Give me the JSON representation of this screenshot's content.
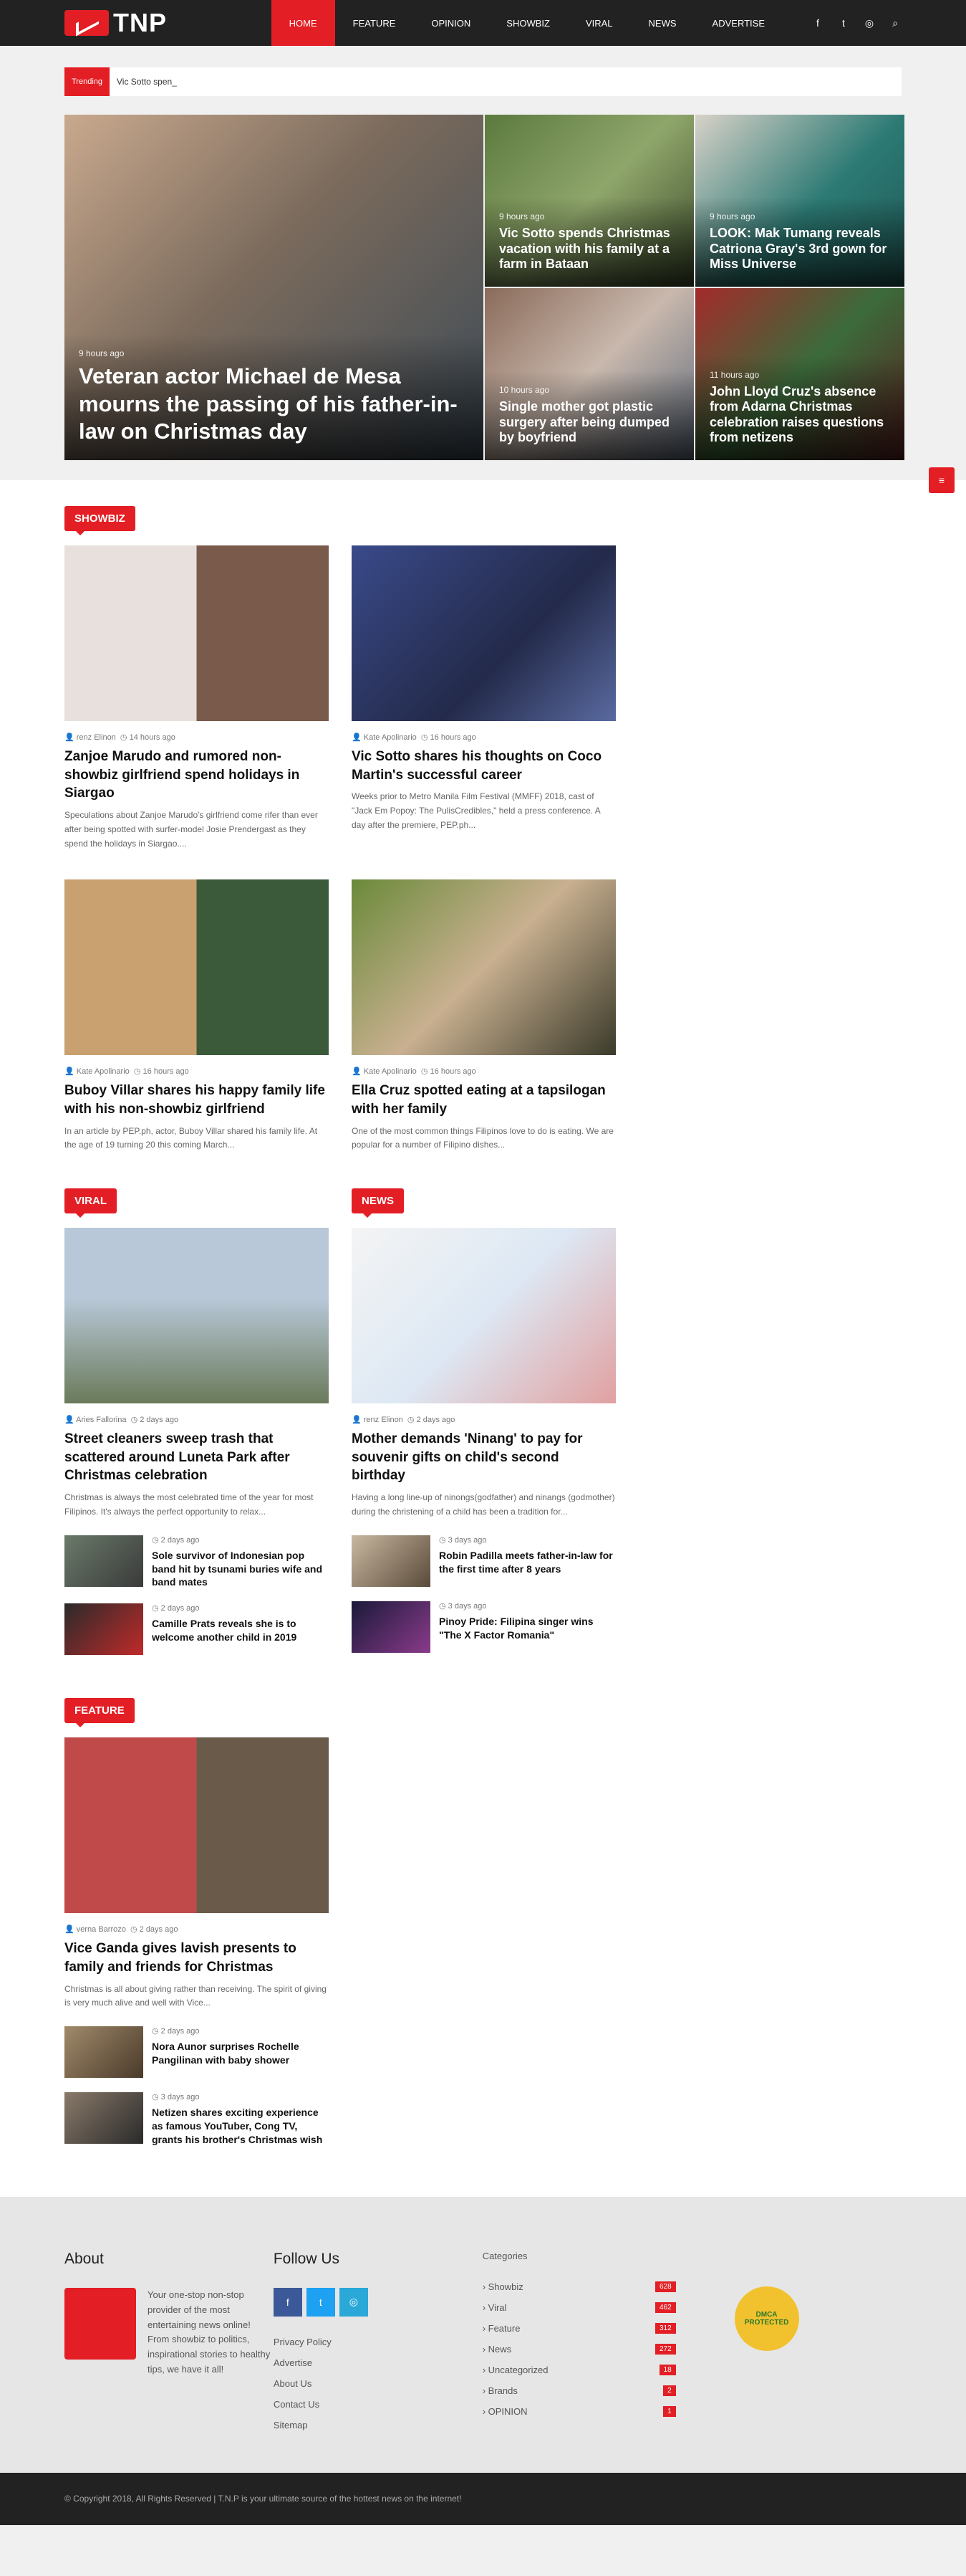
{
  "nav": {
    "logo_text": "TNP",
    "items": [
      "HOME",
      "FEATURE",
      "OPINION",
      "SHOWBIZ",
      "VIRAL",
      "NEWS",
      "ADVERTISE"
    ],
    "social_icons": [
      "facebook-icon",
      "twitter-icon",
      "instagram-icon",
      "search-icon"
    ]
  },
  "trending": {
    "label": "Trending",
    "text": "Vic Sotto spen_"
  },
  "hero": [
    {
      "time": "9 hours ago",
      "title": "Veteran actor Michael de Mesa mourns the passing of his father-in-law on Christmas day"
    },
    {
      "time": "9 hours ago",
      "title": "Vic Sotto spends Christmas vacation with his family at a farm in Bataan"
    },
    {
      "time": "9 hours ago",
      "title": "LOOK: Mak Tumang reveals Catriona Gray's 3rd gown for Miss Universe"
    },
    {
      "time": "10 hours ago",
      "title": "Single mother got plastic surgery after being dumped by boyfriend"
    },
    {
      "time": "11 hours ago",
      "title": "John Lloyd Cruz's absence from Adarna Christmas celebration raises questions from netizens"
    }
  ],
  "showbiz": {
    "label": "SHOWBIZ",
    "cards": [
      {
        "author": "renz Elinon",
        "time": "14 hours ago",
        "title": "Zanjoe Marudo and rumored non-showbiz girlfriend spend holidays in Siargao",
        "excerpt": "Speculations about Zanjoe Marudo's girlfriend come rifer than ever after being spotted with surfer-model Josie Prendergast as they spend the holidays in Siargao...."
      },
      {
        "author": "Kate Apolinario",
        "time": "16 hours ago",
        "title": "Vic Sotto shares his thoughts on Coco Martin's successful career",
        "excerpt": "Weeks prior to Metro Manila Film Festival (MMFF) 2018, cast of \"Jack Em Popoy: The PulisCredibles,\" held a press conference. A day after the premiere, PEP.ph..."
      },
      {
        "author": "Kate Apolinario",
        "time": "16 hours ago",
        "title": "Buboy Villar shares his happy family life with his non-showbiz girlfriend",
        "excerpt": "In an article by PEP.ph, actor, Buboy Villar shared his family life. At the age of 19 turning 20 this coming March..."
      },
      {
        "author": "Kate Apolinario",
        "time": "16 hours ago",
        "title": "Ella Cruz spotted eating at a tapsilogan with her family",
        "excerpt": "One of the most common things Filipinos love to do is eating. We are popular for a number of Filipino dishes..."
      }
    ]
  },
  "viral": {
    "label": "VIRAL",
    "main": {
      "author": "Aries Fallorina",
      "time": "2 days ago",
      "title": "Street cleaners sweep trash that scattered around Luneta Park after Christmas celebration",
      "excerpt": "Christmas is always the most celebrated time of the year for most Filipinos. It's always the perfect opportunity to relax..."
    },
    "smalls": [
      {
        "time": "2 days ago",
        "title": "Sole survivor of Indonesian pop band hit by tsunami buries wife and band mates"
      },
      {
        "time": "2 days ago",
        "title": "Camille Prats reveals she is to welcome another child in 2019"
      }
    ]
  },
  "news": {
    "label": "NEWS",
    "main": {
      "author": "renz Elinon",
      "time": "2 days ago",
      "title": "Mother demands 'Ninang' to pay for souvenir gifts on child's second birthday",
      "excerpt": "Having a long line-up of ninongs(godfather) and ninangs (godmother) during the christening of a child has been a tradition for..."
    },
    "smalls": [
      {
        "time": "3 days ago",
        "title": "Robin Padilla meets father-in-law for the first time after 8 years"
      },
      {
        "time": "3 days ago",
        "title": "Pinoy Pride: Filipina singer wins \"The X Factor Romania\""
      }
    ]
  },
  "feature": {
    "label": "FEATURE",
    "main": {
      "author": "verna Barrozo",
      "time": "2 days ago",
      "title": "Vice Ganda gives lavish presents to family and friends for Christmas",
      "excerpt": "Christmas is all about giving rather than receiving. The spirit of giving is very much alive and well with Vice..."
    },
    "smalls": [
      {
        "time": "2 days ago",
        "title": "Nora Aunor surprises Rochelle Pangilinan with baby shower"
      },
      {
        "time": "3 days ago",
        "title": "Netizen shares exciting experience as famous YouTuber, Cong TV, grants his brother's Christmas wish"
      }
    ]
  },
  "footer": {
    "about_title": "About",
    "about_text": "Your one-stop non-stop provider of the most entertaining news online! From showbiz to politics, inspirational stories to healthy tips, we have it all!",
    "follow_title": "Follow Us",
    "links": [
      "Privacy Policy",
      "Advertise",
      "About Us",
      "Contact Us",
      "Sitemap"
    ],
    "categories_title": "Categories",
    "categories": [
      {
        "name": "Showbiz",
        "count": "628"
      },
      {
        "name": "Viral",
        "count": "462"
      },
      {
        "name": "Feature",
        "count": "312"
      },
      {
        "name": "News",
        "count": "272"
      },
      {
        "name": "Uncategorized",
        "count": "18"
      },
      {
        "name": "Brands",
        "count": "2"
      },
      {
        "name": "OPINION",
        "count": "1"
      }
    ],
    "dmca": "DMCA PROTECTED",
    "copyright": "© Copyright 2018, All Rights Reserved | T.N.P is your ultimate source of the hottest news on the internet!"
  },
  "colors": {
    "accent": "#e31e24",
    "nav_bg": "#222222"
  }
}
